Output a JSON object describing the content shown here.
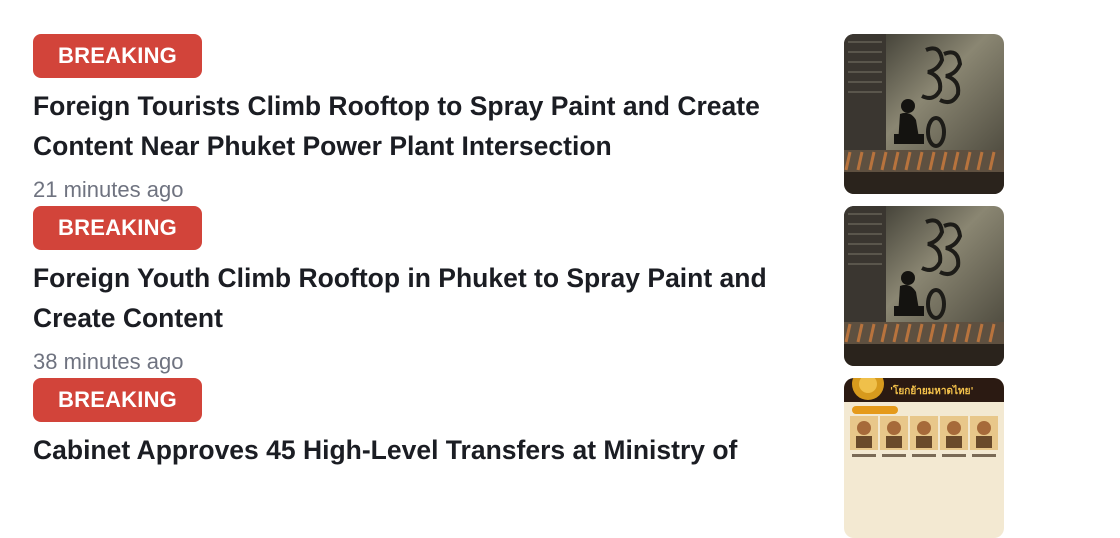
{
  "articles": [
    {
      "badge": "BREAKING",
      "headline": "Foreign Tourists Climb Rooftop to Spray Paint and Create Content Near Phuket Power Plant Intersection",
      "time": "21 minutes ago",
      "thumbnail": "graffiti-rooftop-photo"
    },
    {
      "badge": "BREAKING",
      "headline": "Foreign Youth Climb Rooftop in Phuket to Spray Paint and Create Content",
      "time": "38 minutes ago",
      "thumbnail": "graffiti-rooftop-photo"
    },
    {
      "badge": "BREAKING",
      "headline": "Cabinet Approves 45 High-Level Transfers at Ministry of",
      "time": "",
      "thumbnail": "ministry-officials-poster",
      "thumbnail_caption": "'โยกย้ายมหาดไทย'"
    }
  ],
  "colors": {
    "badge_bg": "#d2443a",
    "badge_text": "#ffffff",
    "headline": "#1b1d23",
    "timestamp": "#6f7380"
  }
}
